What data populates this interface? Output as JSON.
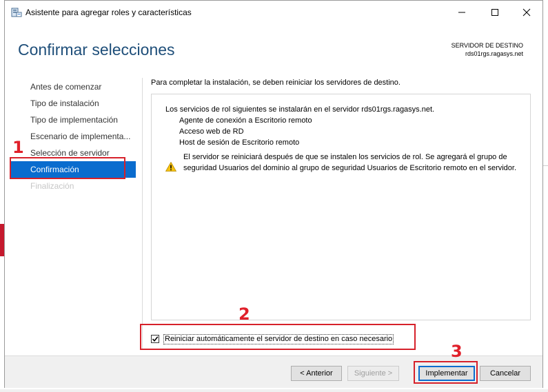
{
  "window": {
    "title": "Asistente para agregar roles y características"
  },
  "header": {
    "page_title": "Confirmar selecciones",
    "server_label": "SERVIDOR DE DESTINO",
    "server_name": "rds01rgs.ragasys.net"
  },
  "nav": {
    "items": [
      {
        "label": "Antes de comenzar"
      },
      {
        "label": "Tipo de instalación"
      },
      {
        "label": "Tipo de implementación"
      },
      {
        "label": "Escenario de implementa..."
      },
      {
        "label": "Selección de servidor"
      },
      {
        "label": "Confirmación"
      },
      {
        "label": "Finalización"
      }
    ]
  },
  "content": {
    "top_text": "Para completar la instalación, se deben reiniciar los servidores de destino.",
    "intro": "Los servicios de rol siguientes se instalarán en el servidor rds01rgs.ragasys.net.",
    "services": [
      "Agente de conexión a Escritorio remoto",
      "Acceso web de RD",
      "Host de sesión de Escritorio remoto"
    ],
    "warning": "El servidor se reiniciará después de que se instalen los servicios de rol. Se agregará el grupo de seguridad Usuarios del dominio al grupo de seguridad Usuarios de Escritorio remoto en el servidor.",
    "restart_checkbox_label": "Reiniciar automáticamente el servidor de destino en caso necesario"
  },
  "footer": {
    "previous": "< Anterior",
    "next": "Siguiente >",
    "deploy": "Implementar",
    "cancel": "Cancelar"
  },
  "annotations": {
    "n1": "1",
    "n2": "2",
    "n3": "3"
  },
  "colors": {
    "accent": "#0a6cce",
    "heading": "#1e4e79",
    "annotation": "#d6202a"
  }
}
